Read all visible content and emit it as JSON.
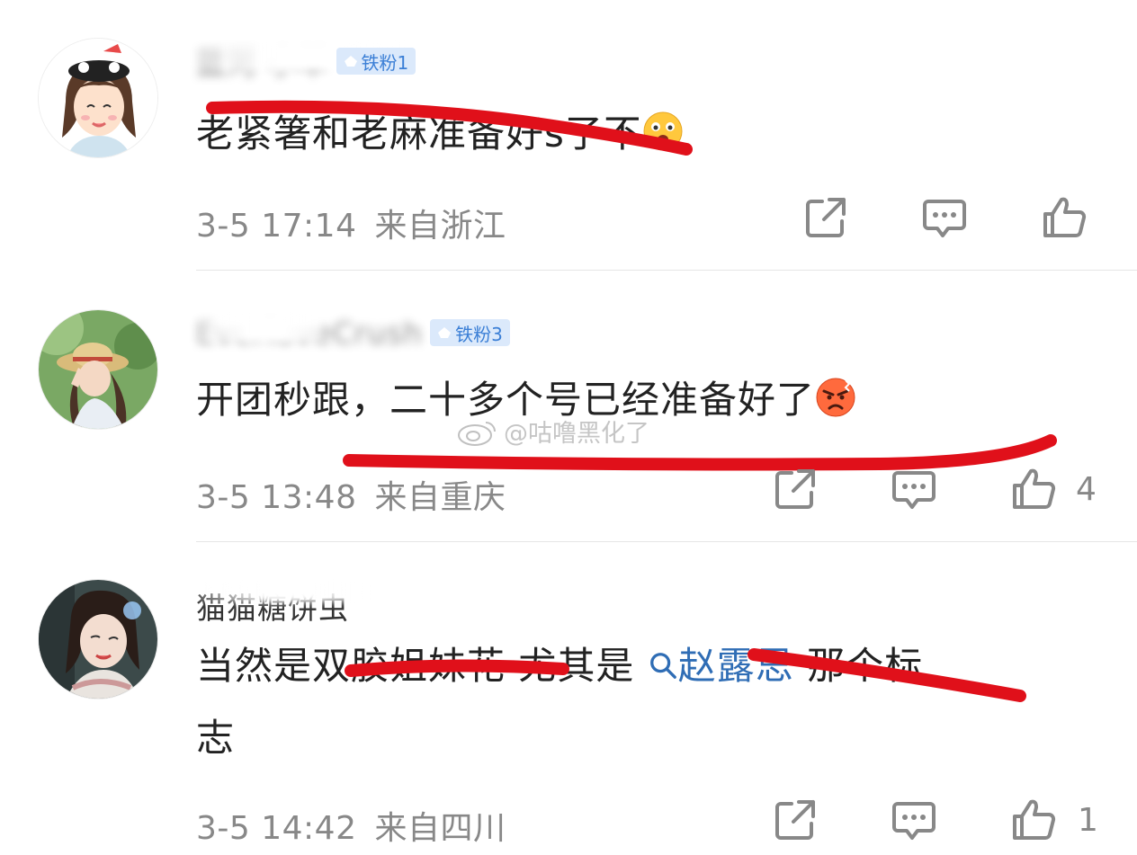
{
  "comments": [
    {
      "username": "蓝河 小羊",
      "badge": "铁粉1",
      "text": "老紧箸和老麻准备好s了不",
      "time": "3-5 17:14",
      "location": "来自浙江",
      "like_count": ""
    },
    {
      "username": "EverloveCrush",
      "badge": "铁粉3",
      "text": "开团秒跟，二十多个号已经准备好了",
      "time": "3-5 13:48",
      "location": "来自重庆",
      "like_count": "4"
    },
    {
      "username": "猫猫糖饼虫",
      "badge": "",
      "text_before": "当然是双胶姐妹花 尤其是",
      "topic": "赵露思",
      "text_after": "那个标",
      "text_line2": "志",
      "time": "3-5 14:42",
      "location": "来自四川",
      "like_count": "1"
    }
  ],
  "watermark": "@咕噜黑化了",
  "colors": {
    "strike": "#e0101a",
    "badge_bg": "#dbe9fb",
    "badge_text": "#3b7fd6",
    "meta": "#888888",
    "link": "#2f6db5"
  },
  "icons": [
    "share-icon",
    "comment-icon",
    "like-icon",
    "emoji-icon",
    "weibo-logo-icon"
  ]
}
